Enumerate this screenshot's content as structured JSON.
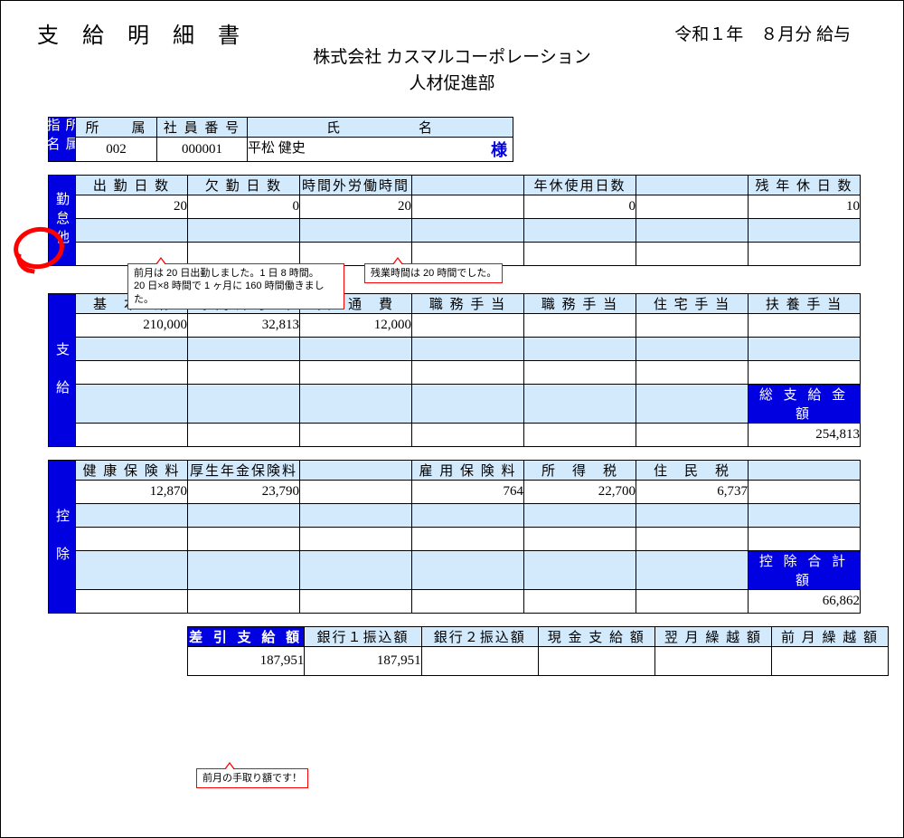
{
  "header": {
    "title": "支 給 明 細 書",
    "date": "令和１年　８月分 給与",
    "company": "株式会社 カスマルコーポレーション",
    "dept": "人材促進部"
  },
  "id_block": {
    "vlabel": "所属指名",
    "col_affil": "所　　属",
    "col_empno": "社 員 番 号",
    "col_name": "氏　　　　　名",
    "affil": "002",
    "empno": "000001",
    "name": "平松 健史",
    "sama": "様"
  },
  "attendance": {
    "vlabel": "勤怠他",
    "h1": "出 勤 日 数",
    "h2": "欠 勤 日 数",
    "h3": "時間外労働時間",
    "h4": "",
    "h5": "年休使用日数",
    "h6": "",
    "h7": "残 年 休 日 数",
    "v1": "20",
    "v2": "0",
    "v3": "20",
    "v5": "0",
    "v7": "10"
  },
  "payment": {
    "vlabel": "支　給",
    "h1": "基　本　給",
    "h2": "時 間 外 手 当",
    "h3": "交　通　費",
    "h4": "職 務 手 当",
    "h5": "職 務 手 当",
    "h6": "住 宅 手 当",
    "h7": "扶 養 手 当",
    "v1": "210,000",
    "v2": "32,813",
    "v3": "12,000",
    "total_label": "総 支 給 金 額",
    "total": "254,813"
  },
  "deduction": {
    "vlabel": "控　除",
    "h1": "健 康 保 険 料",
    "h2": "厚生年金保険料",
    "h3": "",
    "h4": "雇 用 保 険 料",
    "h5": "所　得　税",
    "h6": "住　民　税",
    "h7": "",
    "v1": "12,870",
    "v2": "23,790",
    "v4": "764",
    "v5": "22,700",
    "v6": "6,737",
    "total_label": "控 除 合 計 額",
    "total": "66,862"
  },
  "summary": {
    "h1": "差 引 支 給 額",
    "h2": "銀行１振込額",
    "h3": "銀行２振込額",
    "h4": "現 金 支 給 額",
    "h5": "翌 月 繰 越 額",
    "h6": "前 月 繰 越 額",
    "v1": "187,951",
    "v2": "187,951"
  },
  "callouts": {
    "c1a": "前月は 20 日出勤しました。1 日 8 時間。",
    "c1b": "20 日×8 時間で 1 ヶ月に 160 時間働きました。",
    "c2": "残業時間は 20 時間でした。",
    "c3": "前月の手取り額です！"
  }
}
